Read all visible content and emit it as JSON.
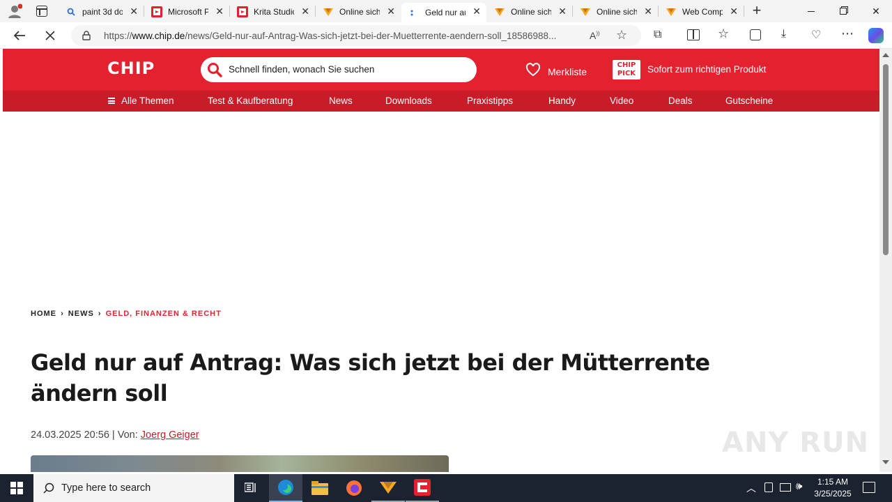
{
  "browser": {
    "tabs": [
      {
        "label": "paint 3d do",
        "icon": "search-icon"
      },
      {
        "label": "Microsoft P",
        "icon": "chip-favicon"
      },
      {
        "label": "Krita Studio",
        "icon": "chip-favicon"
      },
      {
        "label": "Online sich",
        "icon": "online-favicon"
      },
      {
        "label": "Geld nur au",
        "icon": "loading-icon"
      },
      {
        "label": "Online sich",
        "icon": "online-favicon"
      },
      {
        "label": "Online sich",
        "icon": "online-favicon"
      },
      {
        "label": "Web Comp",
        "icon": "online-favicon"
      }
    ],
    "url_prefix": "https://",
    "url_host": "www.chip.de",
    "url_path": "/news/Geld-nur-auf-Antrag-Was-sich-jetzt-bei-der-Muetterrente-aendern-soll_18586988..."
  },
  "site": {
    "logo": "CHIP",
    "search_placeholder": "Schnell finden, wonach Sie suchen",
    "merkliste": "Merkliste",
    "pick_logo_line1": "CHIP",
    "pick_logo_line2": "PICK",
    "pick_text": "Sofort zum richtigen Produkt",
    "nav": [
      "Alle Themen",
      "Test & Kaufberatung",
      "News",
      "Downloads",
      "Praxistipps",
      "Handy",
      "Video",
      "Deals",
      "Gutscheine"
    ]
  },
  "article": {
    "breadcrumb": [
      "HOME",
      "NEWS",
      "GELD, FINANZEN & RECHT"
    ],
    "title_line1": "Geld nur auf Antrag: Was sich jetzt bei der Mütterrente",
    "title_line2": "ändern soll",
    "date": "24.03.2025 20:56",
    "by_label": "| Von:",
    "author": "Joerg Geiger"
  },
  "watermark": "ANY RUN",
  "taskbar": {
    "search_placeholder": "Type here to search",
    "time": "1:15 AM",
    "date": "3/25/2025"
  },
  "colors": {
    "chip_red": "#e4222f",
    "chip_nav_red": "#c81c28",
    "taskbar": "#1c2330"
  }
}
